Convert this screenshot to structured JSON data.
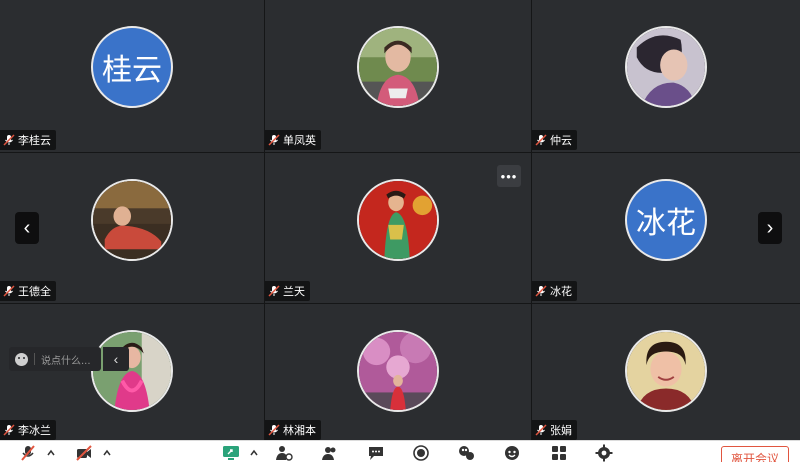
{
  "participants": [
    {
      "name": "李桂云",
      "avatar_text": "桂云",
      "type": "text"
    },
    {
      "name": "单凤英",
      "type": "photo"
    },
    {
      "name": "仲云",
      "type": "photo"
    },
    {
      "name": "王德全",
      "type": "photo"
    },
    {
      "name": "兰天",
      "type": "photo"
    },
    {
      "name": "冰花",
      "avatar_text": "冰花",
      "type": "text"
    },
    {
      "name": "李冰兰",
      "type": "photo"
    },
    {
      "name": "林湘本",
      "type": "photo"
    },
    {
      "name": "张娟",
      "type": "photo"
    }
  ],
  "more_button": "•••",
  "nav": {
    "prev": "‹",
    "next": "›"
  },
  "chat": {
    "placeholder": "说点什么...",
    "collapse": "‹"
  },
  "toolbar": {
    "leave_label": "离开会议"
  },
  "colors": {
    "accent_red": "#e1553f",
    "avatar_blue": "#3a73c9"
  }
}
